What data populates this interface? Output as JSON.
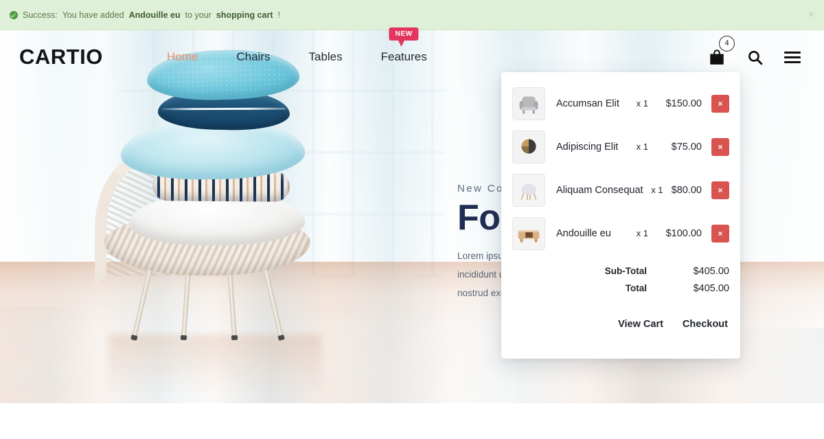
{
  "alert": {
    "icon": "check-circle-icon",
    "prefix": "Success:",
    "middle": " You have added ",
    "product": "Andouille eu",
    "suffix": " to your ",
    "link": "shopping cart",
    "end": "!",
    "close_label": "×",
    "bg_color": "#dff0d8",
    "text_color": "#5a7a4a"
  },
  "header": {
    "logo": "CARTIO",
    "nav": [
      {
        "label": "Home",
        "active": true
      },
      {
        "label": "Chairs",
        "active": false
      },
      {
        "label": "Tables",
        "active": false
      },
      {
        "label": "Features",
        "active": false,
        "badge": "NEW"
      }
    ],
    "actions": {
      "cart_icon": "shopping-bag-icon",
      "cart_count": "4",
      "search_icon": "search-icon",
      "menu_icon": "hamburger-menu-icon"
    },
    "accent_color": "#ef8b6a",
    "badge_color": "#e2365f"
  },
  "hero": {
    "eyebrow": "New Coll",
    "headline": "For",
    "paragraph": "Lorem ipsur\nincididunt u\nnostrud exe",
    "paragraph_lines": [
      "Lorem ipsur",
      "incididunt u",
      "nostrud exe"
    ]
  },
  "cart": {
    "items": [
      {
        "thumb": "armchair-thumbnail",
        "name": "Accumsan Elit",
        "qty": "x 1",
        "price": "$150.00",
        "remove": "×"
      },
      {
        "thumb": "round-chair-thumbnail",
        "name": "Adipiscing Elit",
        "qty": "x 1",
        "price": "$75.00",
        "remove": "×"
      },
      {
        "thumb": "white-chair-thumbnail",
        "name": "Aliquam Consequat",
        "qty": "x 1",
        "price": "$80.00",
        "remove": "×"
      },
      {
        "thumb": "wooden-table-thumbnail",
        "name": "Andouille eu",
        "qty": "x 1",
        "price": "$100.00",
        "remove": "×"
      }
    ],
    "subtotal_label": "Sub-Total",
    "subtotal_value": "$405.00",
    "total_label": "Total",
    "total_value": "$405.00",
    "view_cart_label": "View Cart",
    "checkout_label": "Checkout",
    "remove_color": "#d9534f"
  }
}
